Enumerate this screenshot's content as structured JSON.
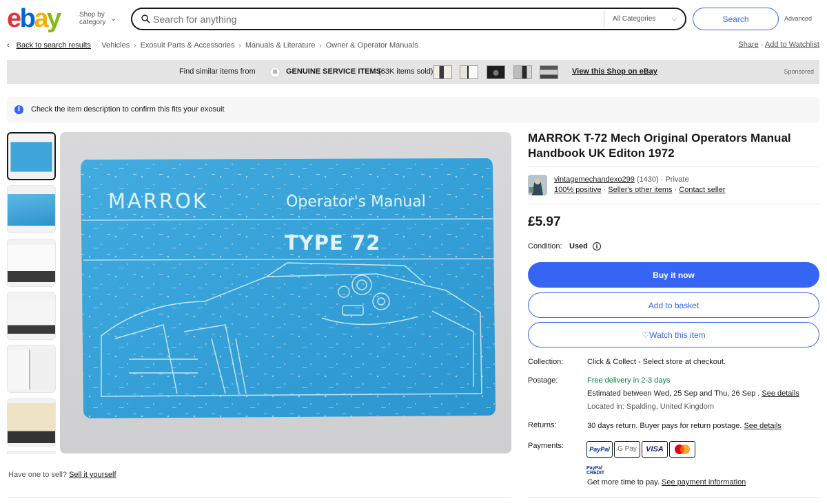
{
  "header": {
    "logo_letters": [
      "e",
      "b",
      "a",
      "y"
    ],
    "shop_by": "Shop by category",
    "search_placeholder": "Search for anything",
    "category": "All Categories",
    "search_button": "Search",
    "advanced": "Advanced"
  },
  "breadcrumb": {
    "back": "Back to search results",
    "items": [
      "Vehicles",
      "Exosuit Parts & Accessories",
      "Manuals & Literature",
      "Owner & Operator Manuals"
    ],
    "share": "Share",
    "watchlist": "Add to Watchlist"
  },
  "banner": {
    "find": "Find similar items from",
    "shop_name": "GENUINE SERVICE ITEMS",
    "sold": "(63K items sold)",
    "view": "View this Shop on eBay",
    "sponsored": "Sponsored"
  },
  "notice": {
    "text": "Check the item description to confirm this fits your exosuit"
  },
  "cover": {
    "brand": "MARROK",
    "heading": "Operator's Manual",
    "model": "TYPE 72"
  },
  "sell": {
    "question": "Have one to sell?",
    "link": "Sell it yourself"
  },
  "product": {
    "title": "MARROK T-72 Mech Original Operators Manual Handbook UK Editon 1972",
    "seller_name": "vintagemechandexo299",
    "seller_count": "(1430)",
    "seller_type": "Private",
    "positive": "100% positive",
    "other_items": "Seller's other items",
    "contact": "Contact seller",
    "price": "£5.97",
    "condition_label": "Condition:",
    "condition_value": "Used",
    "buy": "Buy it now",
    "basket": "Add to basket",
    "watch": "Watch this item",
    "collection_label": "Collection:",
    "collection_value": "Click & Collect - Select store at checkout.",
    "postage_label": "Postage:",
    "postage_free": "Free delivery in 2-3 days",
    "estimated": "Estimated between Wed, 25 Sep and Thu, 26 Sep .",
    "see_details": "See details",
    "located": "Located in: Spalding, United Kingdom",
    "returns_label": "Returns:",
    "returns_value": "30 days return. Buyer pays for return postage.",
    "returns_details": "See details",
    "payments_label": "Payments:",
    "payment_methods": [
      "PayPal",
      "G Pay",
      "VISA",
      "Mastercard"
    ],
    "paypal_credit": "PayPal CREDIT",
    "more_time": "Get more time to pay.",
    "payment_info": "See payment information"
  },
  "colors": {
    "accent": "#3665f3",
    "green": "#05823f",
    "cover_blue": "#3aa7dc"
  }
}
